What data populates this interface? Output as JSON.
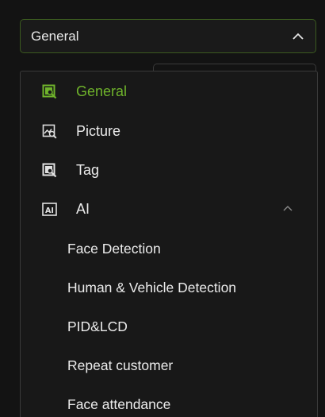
{
  "select": {
    "value": "General",
    "expanded_icon": "chevron-up-icon"
  },
  "menu": {
    "items": [
      {
        "label": "General",
        "icon": "general-settings-icon",
        "active": true
      },
      {
        "label": "Picture",
        "icon": "picture-icon"
      },
      {
        "label": "Tag",
        "icon": "tag-icon"
      },
      {
        "label": "AI",
        "icon": "ai-icon",
        "expanded": true
      },
      {
        "label": "Face Detection"
      },
      {
        "label": "Human & Vehicle Detection"
      },
      {
        "label": "PID&LCD"
      },
      {
        "label": "Repeat customer"
      },
      {
        "label": "Face attendance"
      }
    ]
  },
  "colors": {
    "background": "#131313",
    "accent": "#6fb32b",
    "text": "#ececec",
    "border": "#3a3a3a"
  }
}
